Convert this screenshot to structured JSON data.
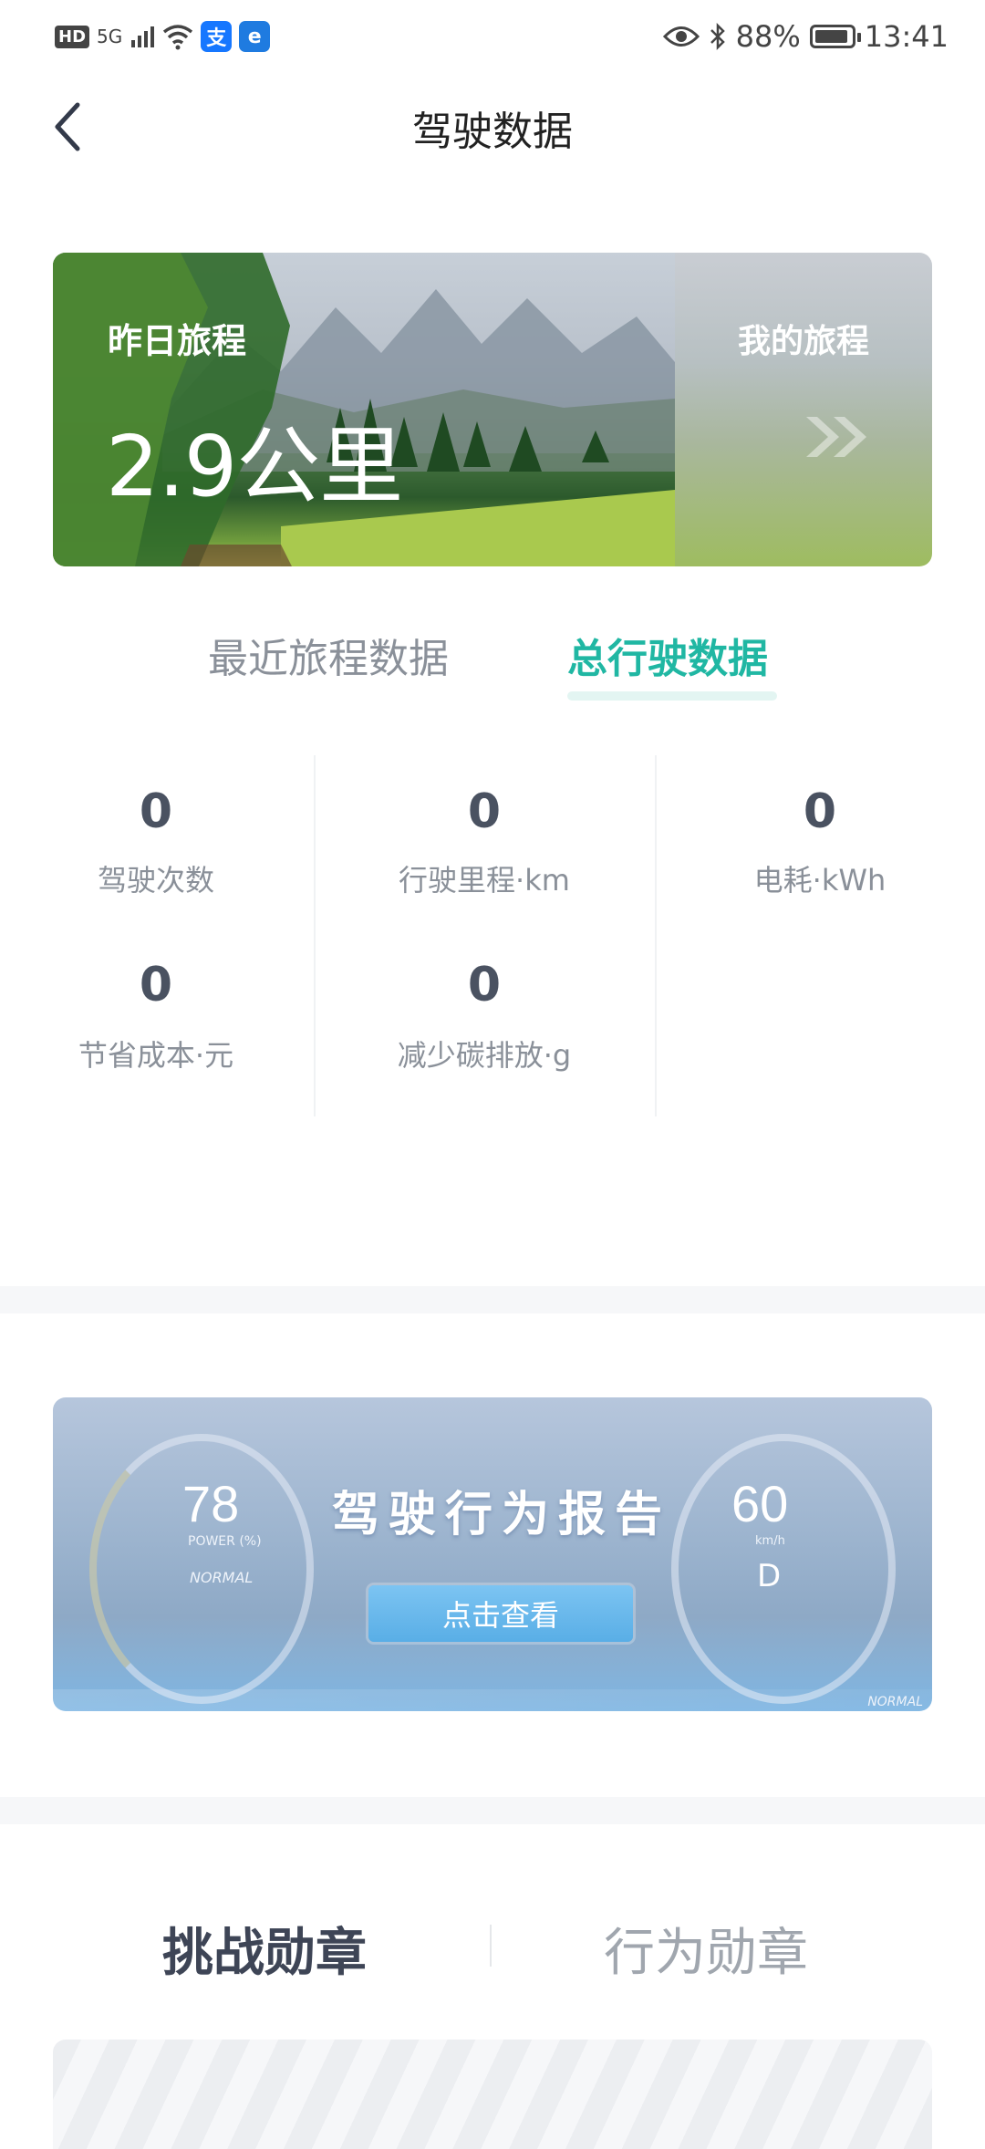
{
  "status_bar": {
    "network_badge": "HD",
    "signal": "5G",
    "app_icons": [
      {
        "name": "alipay-icon",
        "glyph": "支",
        "color": "#1677ff"
      },
      {
        "name": "app-icon",
        "glyph": "e",
        "color": "#1f7be0"
      }
    ],
    "battery_percent": "88%",
    "time": "13:41"
  },
  "header": {
    "title": "驾驶数据"
  },
  "trip_card": {
    "label": "昨日旅程",
    "distance": "2.9公里",
    "my_trips": "我的旅程"
  },
  "tabs": [
    {
      "label": "最近旅程数据",
      "active": false
    },
    {
      "label": "总行驶数据",
      "active": true
    }
  ],
  "stats": [
    {
      "value": "0",
      "label": "驾驶次数"
    },
    {
      "value": "0",
      "label": "行驶里程·km"
    },
    {
      "value": "0",
      "label": "电耗·kWh"
    },
    {
      "value": "0",
      "label": "节省成本·元"
    },
    {
      "value": "0",
      "label": "减少碳排放·g"
    }
  ],
  "banner": {
    "title": "驾驶行为报告",
    "button": "点击查看",
    "left_value": "78",
    "left_unit": "POWER (%)",
    "left_mode": "NORMAL",
    "right_value": "60",
    "right_unit": "km/h",
    "gear": "D",
    "bottom_mode": "NORMAL"
  },
  "medals": {
    "tabs": [
      "挑战勋章",
      "行为勋章"
    ]
  },
  "colors": {
    "accent": "#20b7a3",
    "text_dark": "#3e4556",
    "text_muted": "#8a9099"
  }
}
